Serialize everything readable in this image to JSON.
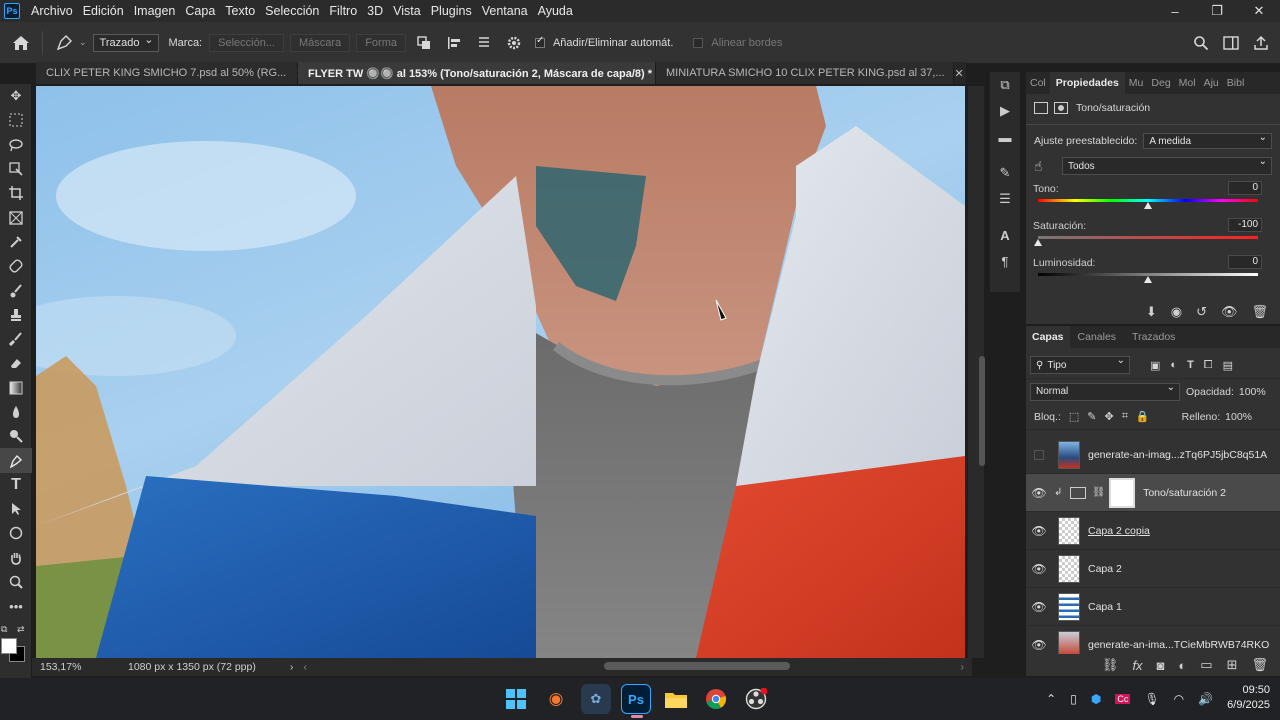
{
  "menu": {
    "items": [
      "Archivo",
      "Edición",
      "Imagen",
      "Capa",
      "Texto",
      "Selección",
      "Filtro",
      "3D",
      "Vista",
      "Plugins",
      "Ventana",
      "Ayuda"
    ]
  },
  "window_controls": {
    "minimize": "–",
    "restore": "❐",
    "close": "✕"
  },
  "options": {
    "mode_value": "Trazado",
    "marca_label": "Marca:",
    "seleccion_label": "Selección...",
    "mascara_label": "Máscara",
    "forma_label": "Forma",
    "auto_add_label": "Añadir/Eliminar automát.",
    "align_edges_label": "Alinear bordes"
  },
  "tabs": [
    {
      "label": "CLIX PETER KING SMICHO 7.psd al 50% (RG...",
      "close": "✕"
    },
    {
      "label": "FLYER TW 🔘🔘 al 153% (Tono/saturación 2, Máscara de capa/8) *",
      "close": "✕"
    },
    {
      "label": "MINIATURA SMICHO 10 CLIX PETER KING.psd al 37,...",
      "close": "✕"
    }
  ],
  "status": {
    "zoom": "153,17%",
    "doc_size": "1080 px x 1350 px (72 ppp)"
  },
  "properties": {
    "tabs": [
      "Col",
      "Propiedades",
      "Mu",
      "Deg",
      "Mol",
      "Aju",
      "Bibl"
    ],
    "title": "Tono/saturación",
    "preset_label": "Ajuste preestablecido:",
    "preset_value": "A medida",
    "channel_value": "Todos",
    "sliders": [
      {
        "label": "Tono:",
        "value": "0",
        "level": 0
      },
      {
        "label": "Saturación:",
        "value": "-100",
        "level": -100
      },
      {
        "label": "Luminosidad:",
        "value": "0",
        "level": 0
      }
    ]
  },
  "layers": {
    "tabs": [
      "Capas",
      "Canales",
      "Trazados"
    ],
    "filter_value": "Tipo",
    "blend_mode": "Normal",
    "opacity_label": "Opacidad:",
    "opacity_value": "100%",
    "lock_label": "Bloq.:",
    "fill_label": "Relleno:",
    "fill_value": "100%",
    "items": [
      {
        "name": "generate-an-imag...zTq6PJ5jbC8q51A",
        "visible": false
      },
      {
        "name": "Tono/saturación 2",
        "visible": true
      },
      {
        "name": "Capa 2 copia",
        "visible": true
      },
      {
        "name": "Capa 2",
        "visible": true
      },
      {
        "name": "Capa 1",
        "visible": true
      },
      {
        "name": "generate-an-ima...TCieMbRWB74RKO",
        "visible": true
      }
    ]
  },
  "taskbar": {
    "apps": [
      "windows-start",
      "blender",
      "davinci",
      "photoshop",
      "file-explorer",
      "chrome",
      "obs"
    ],
    "ps_label": "Ps",
    "time": "09:50",
    "date": "6/9/2025"
  }
}
